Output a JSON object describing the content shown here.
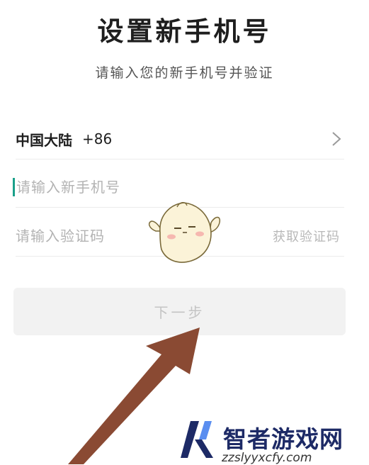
{
  "header": {
    "title": "设置新手机号",
    "subtitle": "请输入您的新手机号并验证"
  },
  "region": {
    "label": "中国大陆",
    "code": "+86"
  },
  "phone_input": {
    "placeholder": "请输入新手机号",
    "value": ""
  },
  "code_input": {
    "placeholder": "请输入验证码",
    "value": "",
    "get_code_label": "获取验证码"
  },
  "next_button": {
    "label": "下一步"
  },
  "watermark": {
    "name": "智者游戏网",
    "url": "zzslyyxcfy.com"
  },
  "colors": {
    "caret": "#1aa08a",
    "arrow": "#8a4a33",
    "watermark": "#1d2a66"
  },
  "icons": [
    "chevron-right-icon",
    "mascot-sticker",
    "arrow-annotation",
    "site-logo-icon"
  ]
}
